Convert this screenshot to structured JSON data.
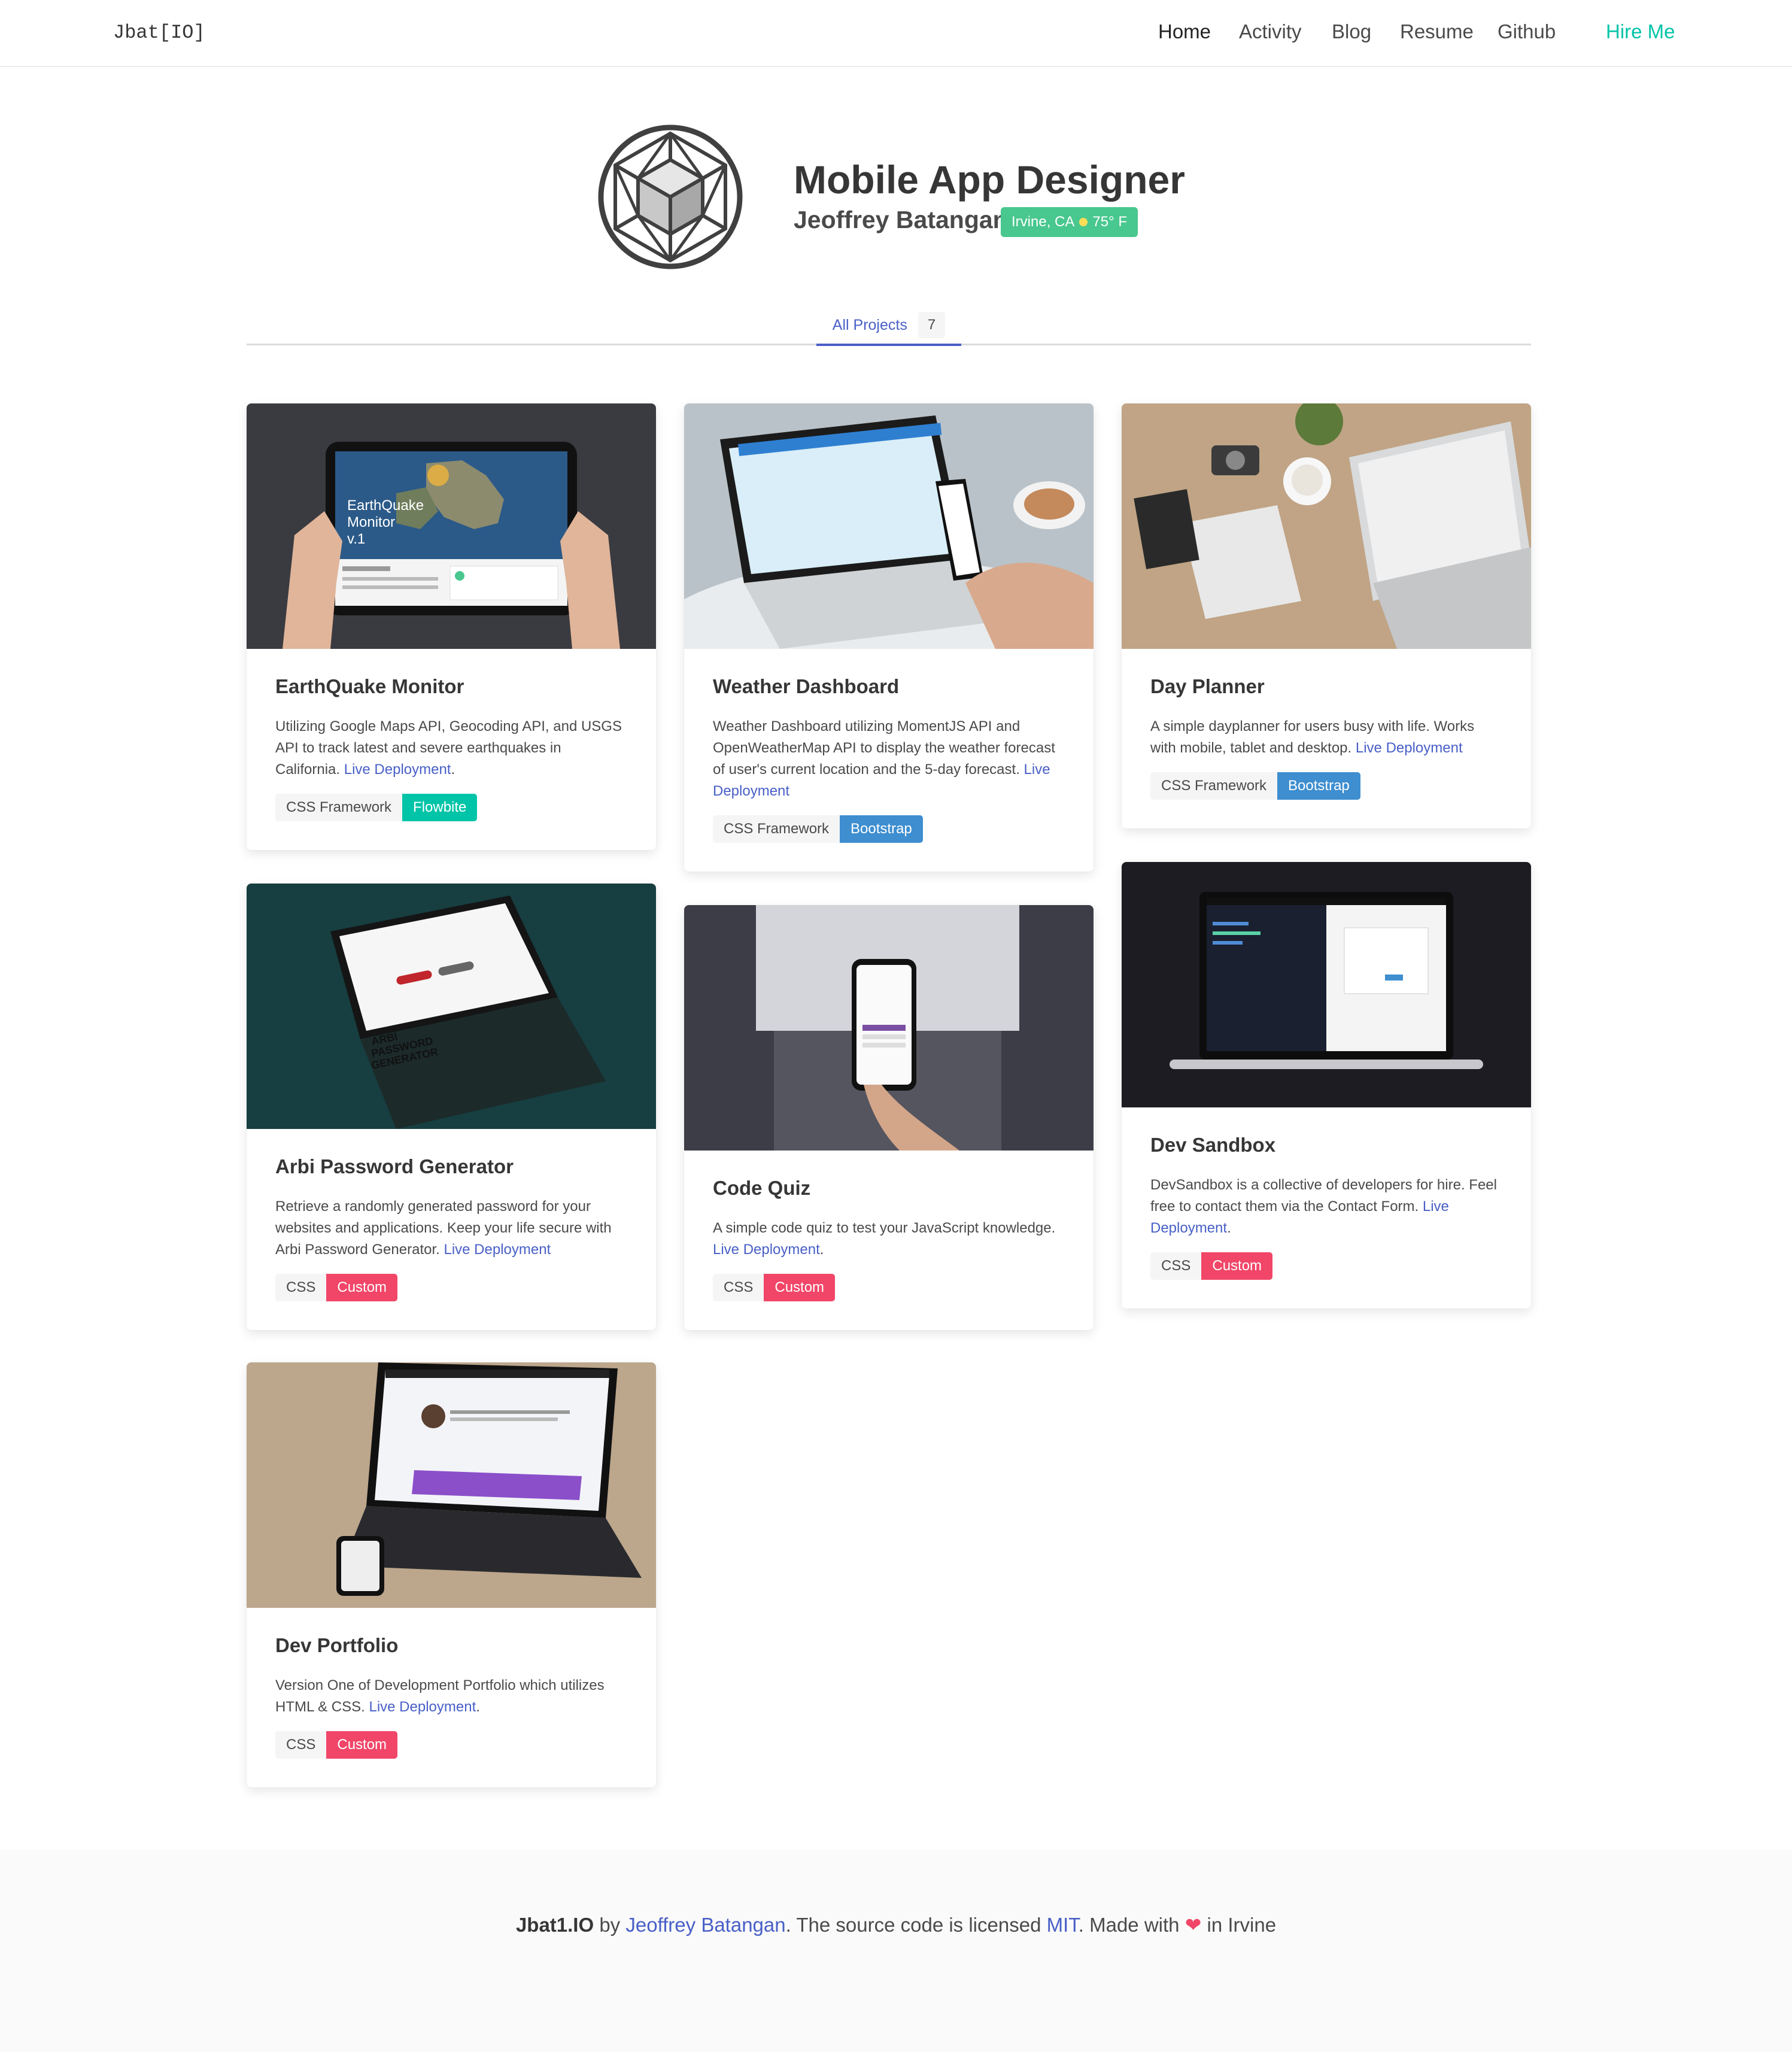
{
  "nav": {
    "brand": "Jbat[IO]",
    "items": [
      {
        "label": "Home"
      },
      {
        "label": "Activity"
      },
      {
        "label": "Blog"
      },
      {
        "label": "Resume"
      },
      {
        "label": "Github"
      },
      {
        "label": "Hire Me"
      }
    ]
  },
  "hero": {
    "title": "Mobile App Designer",
    "subtitle": "Jeoffrey Batangan",
    "location": "Irvine, CA",
    "weather": "75° F"
  },
  "tabs": {
    "label": "All Projects",
    "count": "7"
  },
  "colors": {
    "primary": "#485fc7",
    "success": "#48c78e",
    "teal": "#00c4a7",
    "info": "#3e8ed0",
    "danger": "#f14668"
  },
  "projects": [
    {
      "title": "EarthQuake Monitor",
      "desc": "Utilizing Google Maps API, Geocoding API, and USGS API to track latest and severe earthquakes in California.",
      "link": "Live Deployment",
      "after_link": ".",
      "tag_label": "CSS Framework",
      "tag_value": "Flowbite",
      "image_text": "EarthQuake Monitor v.1"
    },
    {
      "title": "Weather Dashboard",
      "desc": "Weather Dashboard utilizing MomentJS API and OpenWeatherMap API to display the weather forecast of user's current location and the 5-day forecast.",
      "link": "Live Deployment",
      "after_link": "",
      "tag_label": "CSS Framework",
      "tag_value": "Bootstrap"
    },
    {
      "title": "Day Planner",
      "desc": "A simple dayplanner for users busy with life. Works with mobile, tablet and desktop.",
      "link": "Live Deployment",
      "after_link": "",
      "tag_label": "CSS Framework",
      "tag_value": "Bootstrap"
    },
    {
      "title": "Arbi Password Generator",
      "desc": "Retrieve a randomly generated password for your websites and applications. Keep your life secure with Arbi Password Generator.",
      "link": "Live Deployment",
      "after_link": "",
      "tag_label": "CSS",
      "tag_value": "Custom",
      "image_text": "ARBI PASSWORD GENERATOR"
    },
    {
      "title": "Code Quiz",
      "desc": "A simple code quiz to test your JavaScript knowledge.",
      "link": "Live Deployment",
      "after_link": ".",
      "tag_label": "CSS",
      "tag_value": "Custom"
    },
    {
      "title": "Dev Sandbox",
      "desc": "DevSandbox is a collective of developers for hire. Feel free to contact them via the Contact Form.",
      "link": "Live Deployment",
      "after_link": ".",
      "tag_label": "CSS",
      "tag_value": "Custom"
    },
    {
      "title": "Dev Portfolio",
      "desc": "Version One of Development Portfolio which utilizes HTML & CSS.",
      "link": "Live Deployment",
      "after_link": ".",
      "tag_label": "CSS",
      "tag_value": "Custom"
    }
  ],
  "footer": {
    "brand": "Jbat1.IO",
    "by": " by ",
    "author": "Jeoffrey Batangan",
    "licensed": ". The source code is licensed ",
    "license": "MIT",
    "made_with": ". Made with ",
    "heart": "❤",
    "place": " in Irvine"
  }
}
